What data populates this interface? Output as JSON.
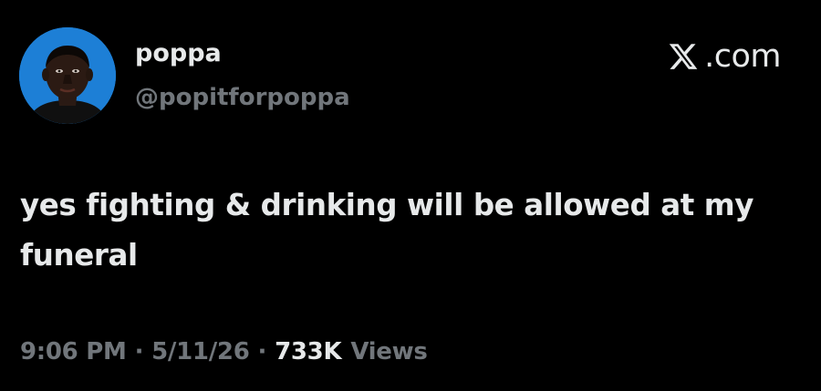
{
  "author": {
    "display_name": "poppa",
    "handle": "@popitforpoppa",
    "avatar": "profile-photo"
  },
  "brand": {
    "icon": "x-logo-icon",
    "domain": ".com"
  },
  "tweet": {
    "text": "yes fighting & drinking will be allowed at my funeral"
  },
  "meta": {
    "time": "9:06 PM",
    "separator": "·",
    "date": "5/11/26",
    "views_count": "733K",
    "views_label": "Views"
  },
  "colors": {
    "background": "#000000",
    "primary_text": "#e7e9ea",
    "secondary_text": "#71767b",
    "avatar_background": "#1d7fd6"
  }
}
